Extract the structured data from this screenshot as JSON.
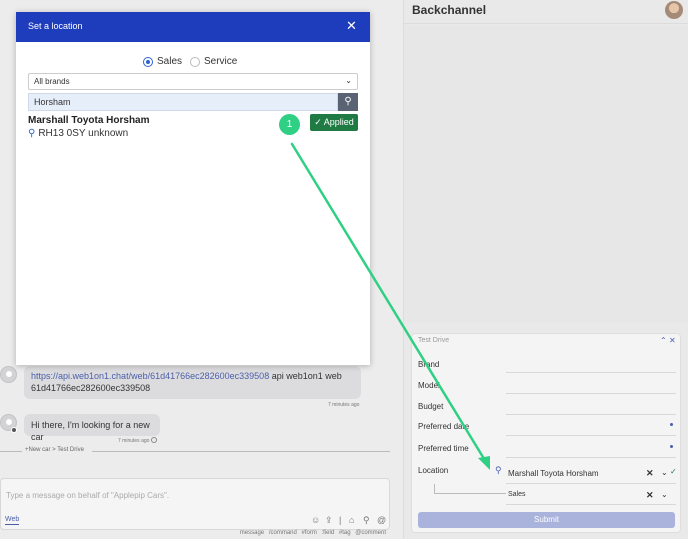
{
  "chat": {
    "messages": [
      {
        "link": "https://api.web1on1.chat/web/61d41766ec282600ec339508",
        "text_after": " api web1on1 web 61d41766ec282600ec339508",
        "time": "7 minutes ago"
      },
      {
        "text": "Hi there, I'm looking for a new car",
        "time": "7 minutes ago"
      }
    ],
    "divider": "+New car > Test Drive",
    "composer": {
      "placeholder": "Type a message  on behalf of \"Applepip Cars\".",
      "tab": "Web",
      "hints": [
        "message",
        "/command",
        "#form",
        ":field",
        "#tag",
        "@comment"
      ]
    }
  },
  "right": {
    "title": "Backchannel",
    "test_drive": {
      "title": "Test Drive",
      "fields": [
        "Brand",
        "Model",
        "Budget",
        "Preferred date",
        "Preferred time",
        "Location"
      ],
      "location_value": "Marshall Toyota Horsham",
      "location_sub_value": "Sales",
      "submit": "Submit"
    }
  },
  "modal": {
    "title": "Set a location",
    "radio_options": [
      "Sales",
      "Service"
    ],
    "selected_radio": "Sales",
    "brand_select": "All brands",
    "search_value": "Horsham",
    "result": {
      "name": "Marshall Toyota Horsham",
      "address": "RH13 0SY unknown"
    },
    "applied_label": "Applied",
    "step_number": "1"
  },
  "colors": {
    "modal_header": "#1e3dbd",
    "applied": "#1f7a44",
    "annotation": "#2fd084",
    "accent": "#4a5ea8"
  }
}
